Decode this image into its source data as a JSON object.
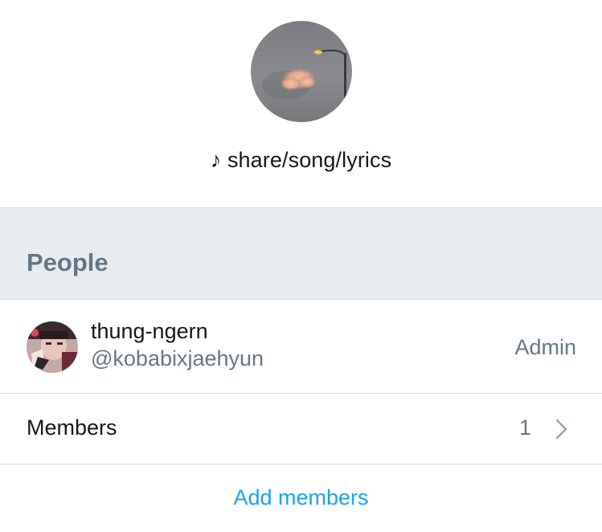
{
  "group": {
    "name": "♪ share/song/lyrics"
  },
  "people_section": {
    "title": "People"
  },
  "members_list": [
    {
      "name": "thung-ngern",
      "handle": "@kobabixjaehyun",
      "role": "Admin"
    }
  ],
  "members_row": {
    "label": "Members",
    "count": "1"
  },
  "actions": {
    "add_members_label": "Add members"
  },
  "colors": {
    "accent": "#1da1f2",
    "section_bg": "#e6ecf0",
    "secondary_text": "#657786",
    "divider": "#d3d9de"
  },
  "icons": {
    "row_chevron": "chevron-right-icon"
  }
}
